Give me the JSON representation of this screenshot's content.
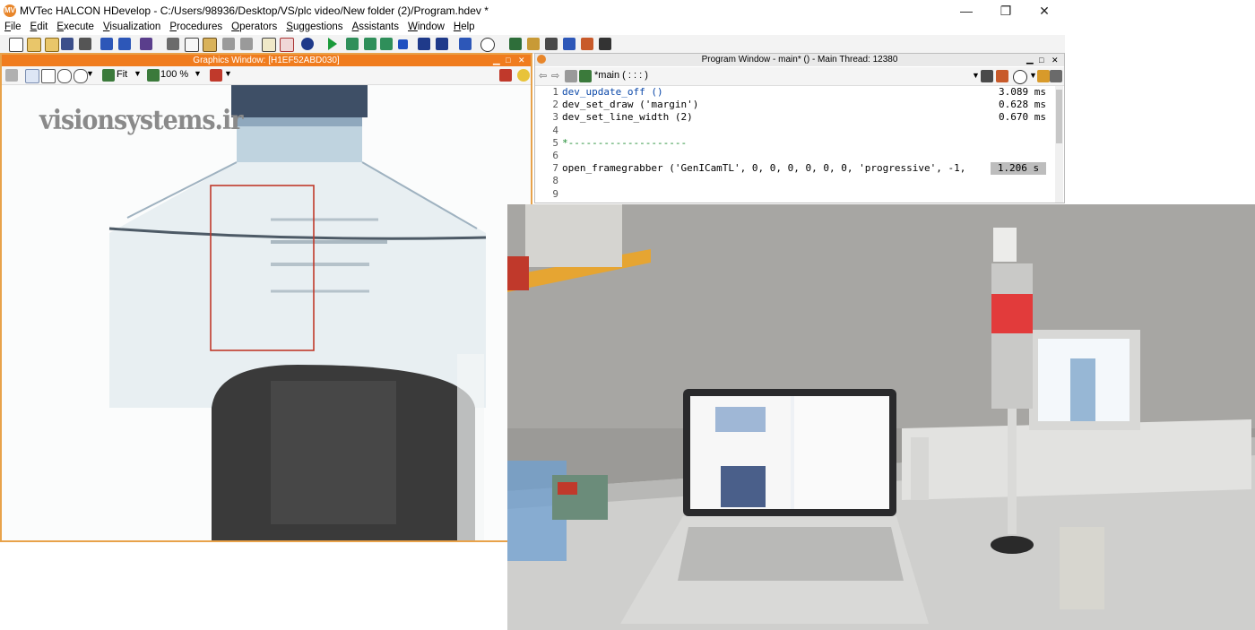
{
  "app": {
    "logo_text": "MV",
    "title": "MVTec HALCON HDevelop - C:/Users/98936/Desktop/VS/plc video/New folder (2)/Program.hdev *",
    "minimize_glyph": "—",
    "maximize_glyph": "❐",
    "close_glyph": "✕"
  },
  "menu": [
    "File",
    "Edit",
    "Execute",
    "Visualization",
    "Procedures",
    "Operators",
    "Suggestions",
    "Assistants",
    "Window",
    "Help"
  ],
  "graphics_window": {
    "title": "Graphics Window: [H1EF52ABD030]",
    "zoom_mode": "Fit",
    "zoom_percent": "100 %",
    "watermark": "visionsystems.ir"
  },
  "program_window": {
    "title": "Program Window - main* () - Main Thread: 12380",
    "procedure": "*main ( : : : )",
    "lines": [
      {
        "n": "1",
        "code": "dev_update_off ()",
        "time": "3.089 ms",
        "kind": "op"
      },
      {
        "n": "2",
        "code": "dev_set_draw ('margin')",
        "time": "0.628 ms",
        "kind": "plain"
      },
      {
        "n": "3",
        "code": "dev_set_line_width (2)",
        "time": "0.670 ms",
        "kind": "plain"
      },
      {
        "n": "4",
        "code": "",
        "time": "",
        "kind": "plain"
      },
      {
        "n": "5",
        "code": "*--------------------",
        "time": "",
        "kind": "comment"
      },
      {
        "n": "6",
        "code": "",
        "time": "",
        "kind": "plain"
      },
      {
        "n": "7",
        "code": "open_framegrabber ('GenICamTL', 0, 0, 0, 0, 0, 0, 'progressive', -1,",
        "time": "1.206 s",
        "kind": "plain"
      },
      {
        "n": "8",
        "code": "",
        "time": "",
        "kind": "plain"
      },
      {
        "n": "9",
        "code": "",
        "time": "",
        "kind": "plain"
      }
    ]
  },
  "colors": {
    "accent_orange": "#f07c1e",
    "comment_green": "#1a8a2e",
    "operator_blue": "#0a47a8",
    "roi_red": "#c0392b"
  }
}
